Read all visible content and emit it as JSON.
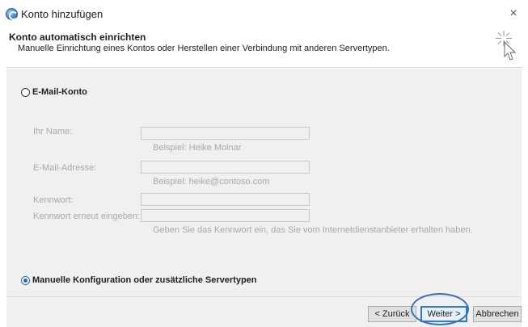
{
  "window": {
    "title": "Konto hinzufügen",
    "close_glyph": "×"
  },
  "header": {
    "title": "Konto automatisch einrichten",
    "subtitle": "Manuelle Einrichtung eines Kontos oder Herstellen einer Verbindung mit anderen Servertypen."
  },
  "options": {
    "email_account": {
      "label": "E-Mail-Konto",
      "selected": false
    },
    "manual_config": {
      "label": "Manuelle Konfiguration oder zusätzliche Servertypen",
      "selected": true
    }
  },
  "form": {
    "name": {
      "label": "Ihr Name:",
      "value": "",
      "hint": "Beispiel: Heike Molnar"
    },
    "email": {
      "label": "E-Mail-Adresse:",
      "value": "",
      "hint": "Beispiel: heike@contoso.com"
    },
    "password": {
      "label": "Kennwort:",
      "value": ""
    },
    "password_confirm": {
      "label": "Kennwort erneut eingeben:",
      "value": ""
    },
    "password_hint": "Geben Sie das Kennwort ein, das Sie vom Internetdienstanbieter erhalten haben."
  },
  "buttons": {
    "back": "< Zurück",
    "next": "Weiter >",
    "cancel": "Abbrechen"
  },
  "colors": {
    "accent": "#1c6ad1",
    "highlight": "#3b6fb8",
    "disabled_text": "#a8a8a8",
    "panel_bg": "#f0f0f0"
  }
}
